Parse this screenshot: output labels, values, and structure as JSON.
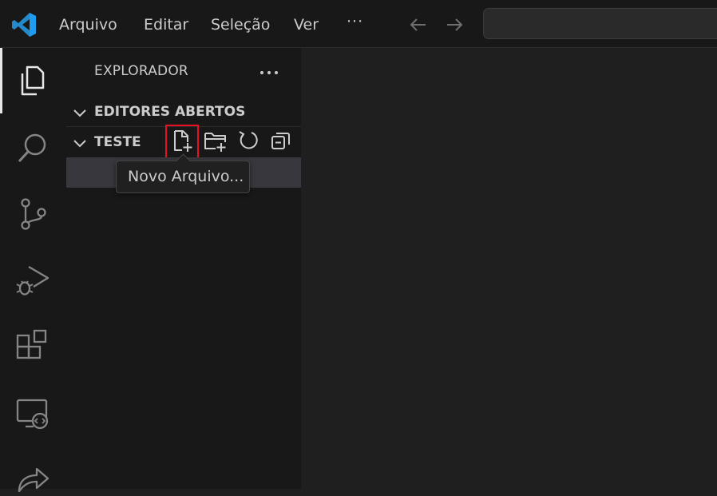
{
  "menu": {
    "items": [
      "Arquivo",
      "Editar",
      "Seleção",
      "Ver"
    ],
    "more": "···"
  },
  "activity_bar": {
    "icons": [
      "explorer-icon",
      "search-icon",
      "source-control-icon",
      "run-debug-icon",
      "extensions-icon",
      "remote-explorer-icon",
      "live-share-icon"
    ],
    "active": "explorer-icon"
  },
  "sidebar": {
    "title": "EXPLORADOR",
    "open_editors_label": "EDITORES ABERTOS",
    "folder_label": "TESTE",
    "toolbar_icons": [
      "new-file-icon",
      "new-folder-icon",
      "refresh-icon",
      "collapse-all-icon"
    ]
  },
  "tooltip": {
    "text": "Novo Arquivo..."
  },
  "colors": {
    "accent_logo": "#2489ca",
    "highlight": "#e81123",
    "selected_row": "#37373d"
  }
}
